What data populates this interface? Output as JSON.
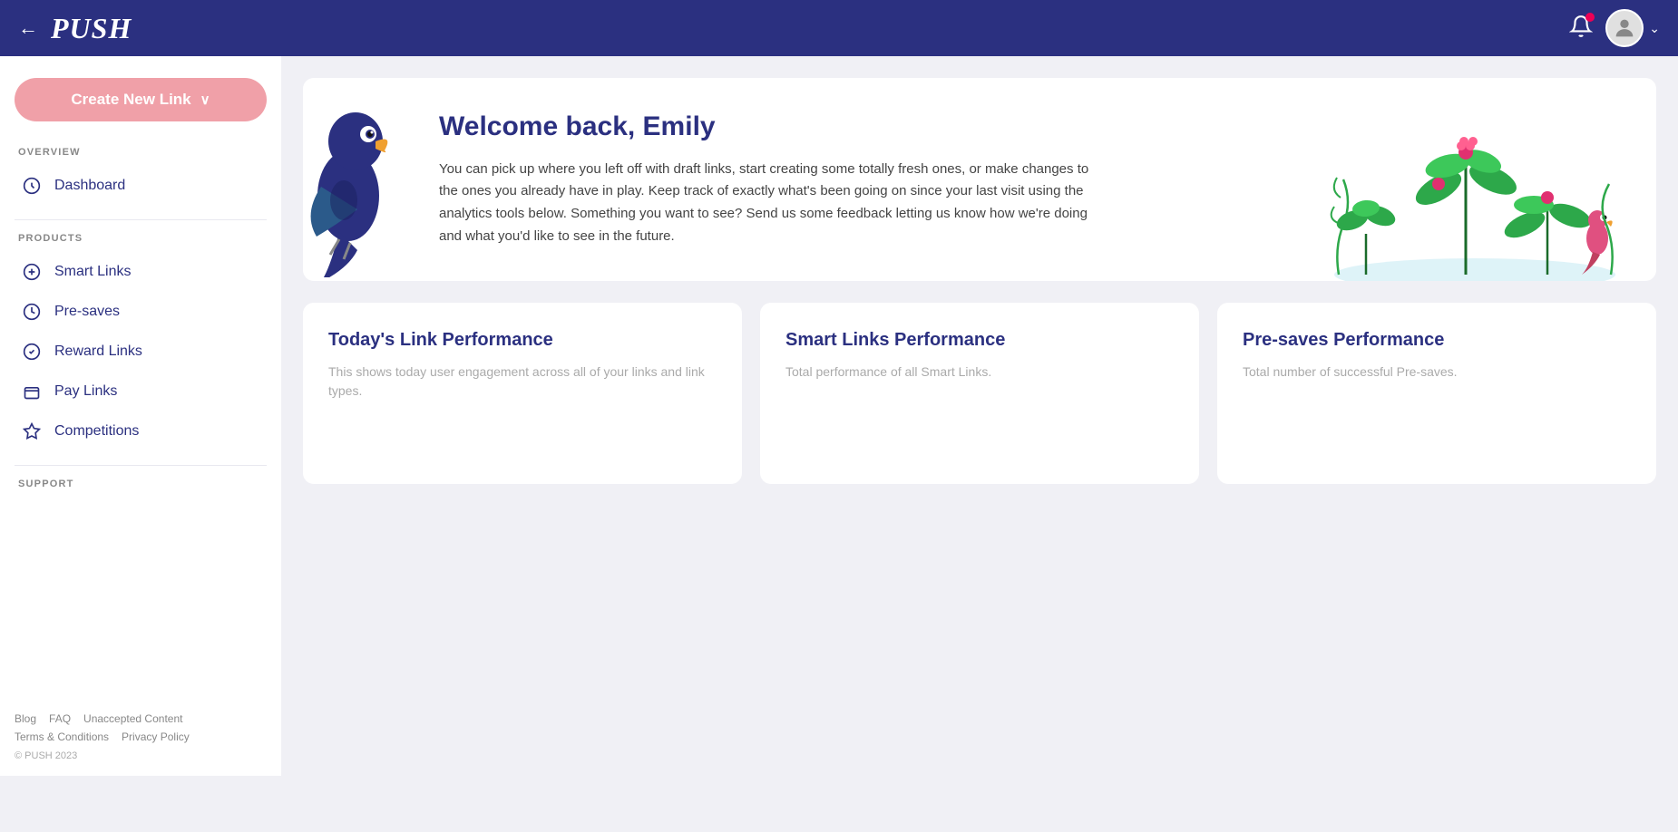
{
  "topnav": {
    "logo": "PUSH",
    "back_label": "←"
  },
  "sidebar": {
    "create_btn_label": "Create New Link",
    "create_btn_chevron": "∨",
    "sections": [
      {
        "label": "OVERVIEW",
        "items": [
          {
            "id": "dashboard",
            "label": "Dashboard",
            "icon": "dashboard-icon"
          }
        ]
      },
      {
        "label": "PRODUCTS",
        "items": [
          {
            "id": "smart-links",
            "label": "Smart Links",
            "icon": "smart-links-icon"
          },
          {
            "id": "pre-saves",
            "label": "Pre-saves",
            "icon": "pre-saves-icon"
          },
          {
            "id": "reward-links",
            "label": "Reward Links",
            "icon": "reward-links-icon"
          },
          {
            "id": "pay-links",
            "label": "Pay Links",
            "icon": "pay-links-icon"
          },
          {
            "id": "competitions",
            "label": "Competitions",
            "icon": "competitions-icon"
          }
        ]
      }
    ],
    "support_label": "SUPPORT",
    "footer_links": [
      "Blog",
      "FAQ",
      "Unaccepted Content",
      "Terms & Conditions",
      "Privacy Policy"
    ],
    "copyright": "© PUSH 2023"
  },
  "welcome": {
    "title": "Welcome back, Emily",
    "body": "You can pick up where you left off with draft links, start creating some totally fresh ones, or make changes to the ones you already have in play. Keep track of exactly what's been going on since your last visit using the analytics tools below. Something you want to see? Send us some feedback letting us know how we're doing and what you'd like to see in the future."
  },
  "cards": [
    {
      "id": "today-link-performance",
      "title": "Today's Link Performance",
      "desc": "This shows today user engagement across all of your links and link types."
    },
    {
      "id": "smart-links-performance",
      "title": "Smart Links Performance",
      "desc": "Total performance of all Smart Links."
    },
    {
      "id": "pre-saves-performance",
      "title": "Pre-saves Performance",
      "desc": "Total number of successful Pre-saves."
    }
  ]
}
